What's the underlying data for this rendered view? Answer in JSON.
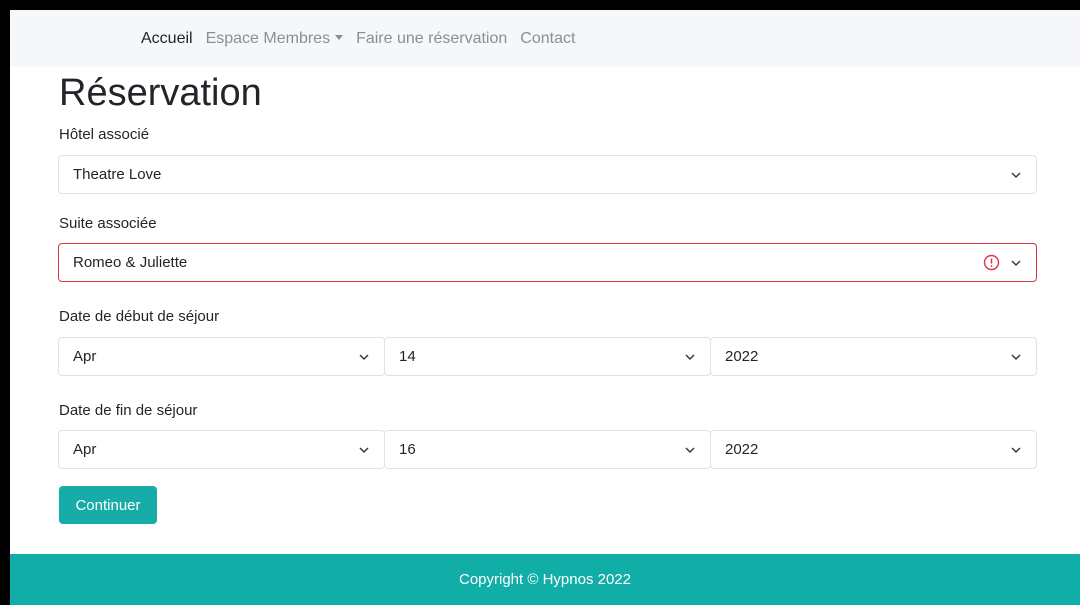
{
  "nav": {
    "items": [
      {
        "label": "Accueil",
        "active": true
      },
      {
        "label": "Espace Membres",
        "dropdown": true
      },
      {
        "label": "Faire une réservation"
      },
      {
        "label": "Contact"
      }
    ]
  },
  "page": {
    "title": "Réservation"
  },
  "form": {
    "hotel": {
      "label": "Hôtel associé",
      "value": "Theatre Love"
    },
    "suite": {
      "label": "Suite associée",
      "value": "Romeo & Juliette",
      "invalid": true
    },
    "start": {
      "label": "Date de début de séjour",
      "month": "Apr",
      "day": "14",
      "year": "2022"
    },
    "end": {
      "label": "Date de fin de séjour",
      "month": "Apr",
      "day": "16",
      "year": "2022"
    },
    "submit_label": "Continuer"
  },
  "footer": {
    "text": "Copyright © Hypnos 2022"
  },
  "colors": {
    "accent": "#17aca7",
    "error": "#dc3545",
    "navbar_bg": "#f5f7fa"
  }
}
